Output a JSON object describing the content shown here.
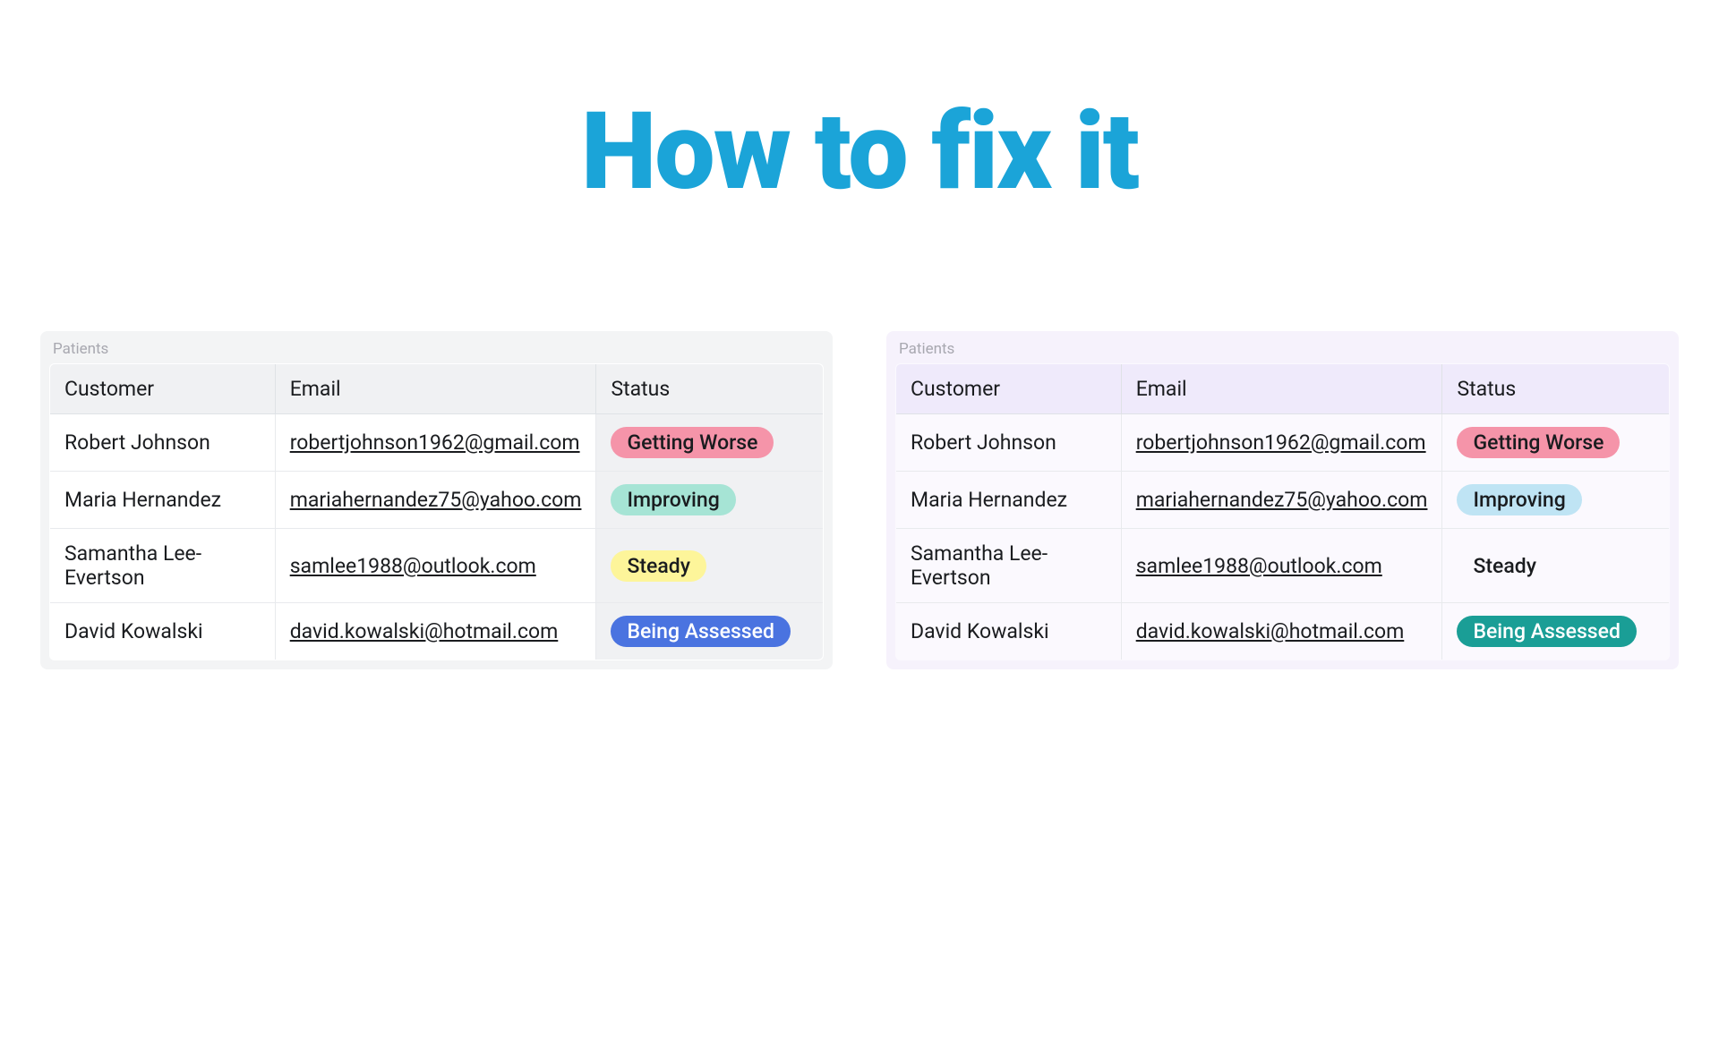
{
  "title": "How to fix it",
  "leftTable": {
    "label": "Patients",
    "headers": {
      "customer": "Customer",
      "email": "Email",
      "status": "Status"
    },
    "rows": [
      {
        "customer": "Robert Johnson",
        "email": "robertjohnson1962@gmail.com",
        "status": "Getting Worse",
        "badgeColor": "#f594a9",
        "textColor": "dark"
      },
      {
        "customer": "Maria Hernandez",
        "email": "mariahernandez75@yahoo.com",
        "status": "Improving",
        "badgeColor": "#a6e4d5",
        "textColor": "dark"
      },
      {
        "customer": "Samantha Lee-Evertson",
        "email": "samlee1988@outlook.com",
        "status": "Steady",
        "badgeColor": "#fdf59a",
        "textColor": "dark"
      },
      {
        "customer": "David Kowalski",
        "email": "david.kowalski@hotmail.com",
        "status": "Being Assessed",
        "badgeColor": "#4a73e0",
        "textColor": "white"
      }
    ]
  },
  "rightTable": {
    "label": "Patients",
    "headers": {
      "customer": "Customer",
      "email": "Email",
      "status": "Status"
    },
    "rows": [
      {
        "customer": "Robert Johnson",
        "email": "robertjohnson1962@gmail.com",
        "status": "Getting Worse",
        "badgeColor": "#f594a9",
        "textColor": "dark"
      },
      {
        "customer": "Maria Hernandez",
        "email": "mariahernandez75@yahoo.com",
        "status": "Improving",
        "badgeColor": "#bfe4f4",
        "textColor": "dark"
      },
      {
        "customer": "Samantha Lee-Evertson",
        "email": "samlee1988@outlook.com",
        "status": "Steady",
        "badgeColor": "transparent",
        "textColor": "dark"
      },
      {
        "customer": "David Kowalski",
        "email": "david.kowalski@hotmail.com",
        "status": "Being Assessed",
        "badgeColor": "#1a9e96",
        "textColor": "white"
      }
    ]
  }
}
